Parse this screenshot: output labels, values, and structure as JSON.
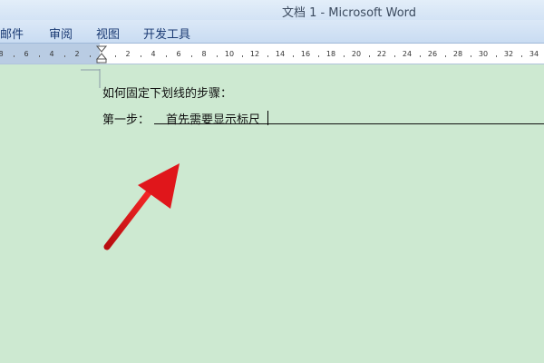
{
  "window": {
    "title": "文档 1 - Microsoft Word"
  },
  "menu": {
    "items": [
      {
        "label": "邮件"
      },
      {
        "label": "审阅"
      },
      {
        "label": "视图"
      },
      {
        "label": "开发工具"
      }
    ]
  },
  "ruler": {
    "labels": [
      "8",
      "6",
      "4",
      "2",
      "2",
      "4",
      "6",
      "8",
      "10",
      "12",
      "14",
      "16",
      "18",
      "20",
      "22",
      "24",
      "26",
      "28",
      "30",
      "32",
      "34"
    ]
  },
  "document": {
    "line1": "如何固定下划线的步骤：",
    "line2_prefix": "第一步：",
    "line2_text": "首先需要显示标尺"
  },
  "colors": {
    "page_background": "#cde9d1",
    "annotation_arrow": "#e0161b"
  }
}
